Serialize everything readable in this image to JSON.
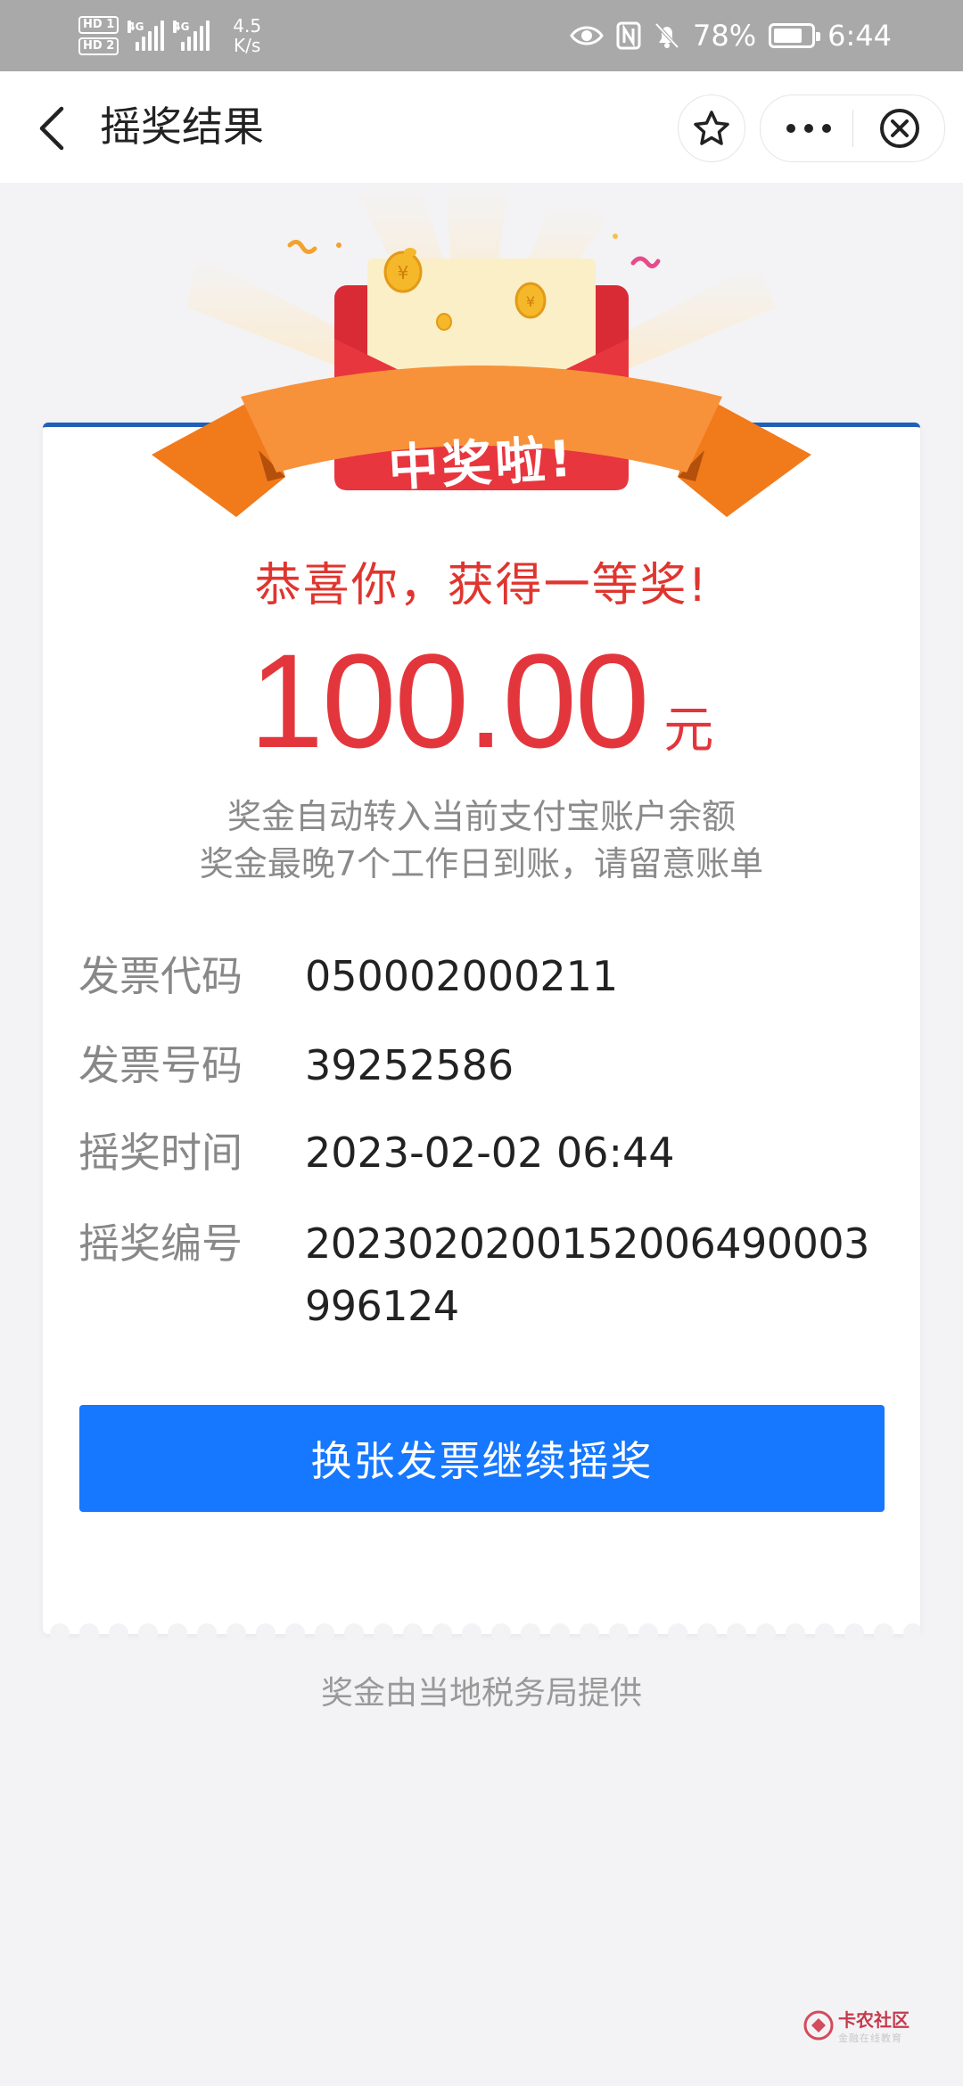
{
  "status_bar": {
    "hd1": "HD 1",
    "hd2": "HD 2",
    "net1": "4G",
    "net2": "4G",
    "net_speed_value": "4.5",
    "net_speed_unit": "K/s",
    "battery_percent": "78%",
    "battery_level": 0.78,
    "time": "6:44",
    "icons": [
      "eye-icon",
      "nfc-icon",
      "bell-off-icon",
      "battery-icon"
    ]
  },
  "nav": {
    "title": "摇奖结果",
    "back_icon": "chevron-left-icon",
    "favorite_icon": "star-outline-icon",
    "more_icon": "more-dots-icon",
    "close_icon": "close-circle-icon"
  },
  "banner": {
    "ribbon_text": "中奖啦!"
  },
  "result": {
    "headline": "恭喜你，获得一等奖!",
    "amount": "100.00",
    "unit": "元",
    "note_line1": "奖金自动转入当前支付宝账户余额",
    "note_line2": "奖金最晚7个工作日到账，请留意账单"
  },
  "details": [
    {
      "label": "发票代码",
      "value": "050002000211"
    },
    {
      "label": "发票号码",
      "value": "39252586"
    },
    {
      "label": "摇奖时间",
      "value": "2023-02-02 06:44"
    },
    {
      "label": "摇奖编号",
      "value": "2023020200152006490003996124"
    }
  ],
  "action_button_label": "换张发票继续摇奖",
  "footer_note": "奖金由当地税务局提供",
  "watermark": {
    "title": "卡农社区",
    "subtitle": "金融在线教育"
  },
  "colors": {
    "accent_blue": "#1677ff",
    "prize_red": "#e3363c",
    "ribbon_orange": "#f7923a",
    "envelope_red": "#e8363e"
  }
}
